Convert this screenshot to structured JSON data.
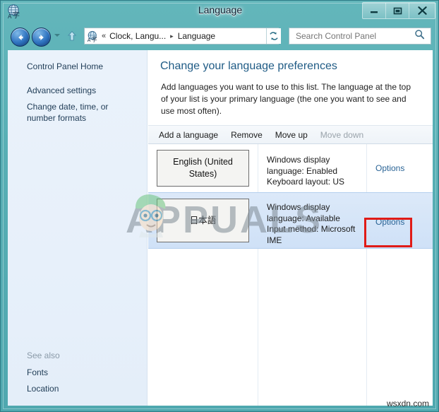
{
  "window": {
    "title": "Language",
    "icon": "language-globe-icon",
    "frame_color": "#4fa8af",
    "controls": {
      "minimize": "Minimize",
      "maximize": "Maximize",
      "close": "Close"
    }
  },
  "nav": {
    "back": "Back",
    "forward": "Forward",
    "recent_pages": "Recent pages",
    "up": "Up one level",
    "refresh": "Refresh"
  },
  "address": {
    "icon": "language-globe-icon",
    "overflow": "«",
    "crumbs": [
      "Clock, Langu...",
      "Language"
    ],
    "separator": "▸",
    "dropdown": "Previous locations"
  },
  "search": {
    "placeholder": "Search Control Panel",
    "value": "",
    "icon": "search-icon"
  },
  "sidebar": {
    "top_links": [
      "Control Panel Home"
    ],
    "links": [
      "Advanced settings",
      "Change date, time, or number formats"
    ],
    "see_also_label": "See also",
    "see_also": [
      "Fonts",
      "Location"
    ]
  },
  "main": {
    "title": "Change your language preferences",
    "description": "Add languages you want to use to this list. The language at the top of your list is your primary language (the one you want to see and use most often).",
    "toolbar": [
      {
        "label": "Add a language",
        "disabled": false
      },
      {
        "label": "Remove",
        "disabled": false
      },
      {
        "label": "Move up",
        "disabled": false
      },
      {
        "label": "Move down",
        "disabled": true
      }
    ],
    "languages": [
      {
        "name": "English (United States)",
        "info": "Windows display language: Enabled\nKeyboard layout: US",
        "options_label": "Options",
        "selected": false,
        "highlighted": false
      },
      {
        "name": "日本語",
        "info": "Windows display language: Available\nInput method: Microsoft IME",
        "options_label": "Options",
        "selected": true,
        "highlighted": true
      }
    ]
  },
  "annotation": {
    "highlight_color": "#e01b17",
    "target": "Options"
  },
  "watermarks": {
    "logo_text": "APPUALS",
    "bottom_right": "wsxdn.com"
  }
}
